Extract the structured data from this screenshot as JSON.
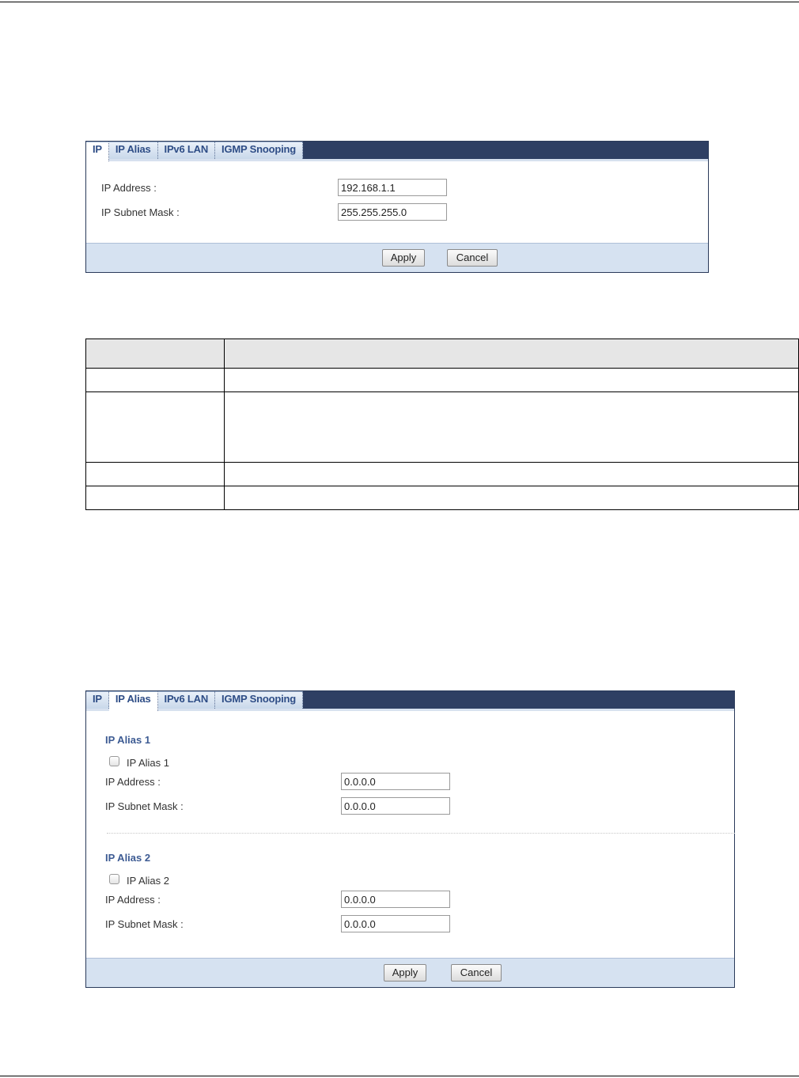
{
  "panel1": {
    "tabs": [
      "IP",
      "IP Alias",
      "IPv6 LAN",
      "IGMP Snooping"
    ],
    "active_tab": "IP",
    "fields": [
      {
        "label": "IP Address :",
        "value": "192.168.1.1"
      },
      {
        "label": "IP Subnet Mask :",
        "value": "255.255.255.0"
      }
    ],
    "apply_label": "Apply",
    "cancel_label": "Cancel"
  },
  "table": {
    "header": [
      "",
      ""
    ],
    "rows": [
      [
        "",
        ""
      ],
      [
        "",
        ""
      ],
      [
        "",
        ""
      ],
      [
        "",
        ""
      ]
    ]
  },
  "panel2": {
    "tabs": [
      "IP",
      "IP Alias",
      "IPv6 LAN",
      "IGMP Snooping"
    ],
    "active_tab": "IP Alias",
    "alias1": {
      "title": "IP Alias 1",
      "checkbox_label": "IP Alias 1",
      "checked": false,
      "address_label": "IP Address :",
      "address_value": "0.0.0.0",
      "mask_label": "IP Subnet Mask :",
      "mask_value": "0.0.0.0"
    },
    "alias2": {
      "title": "IP Alias 2",
      "checkbox_label": "IP Alias 2",
      "checked": false,
      "address_label": "IP Address :",
      "address_value": "0.0.0.0",
      "mask_label": "IP Subnet Mask :",
      "mask_value": "0.0.0.0"
    },
    "apply_label": "Apply",
    "cancel_label": "Cancel"
  }
}
